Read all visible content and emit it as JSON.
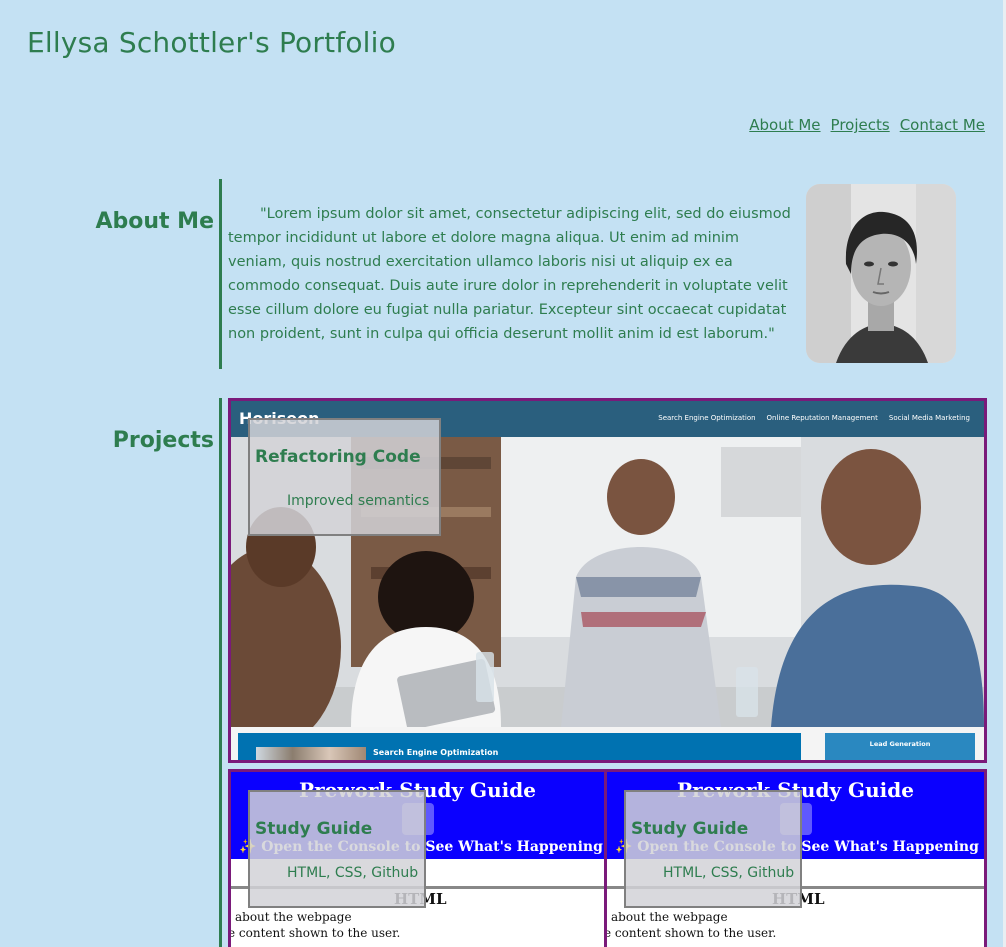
{
  "site": {
    "title": "Ellysa Schottler's Portfolio"
  },
  "nav": {
    "items": [
      "About Me",
      "Projects",
      "Contact Me"
    ]
  },
  "about": {
    "heading": "About Me",
    "text": "\"Lorem ipsum dolor sit amet, consectetur adipiscing elit, sed do eiusmod tempor incididunt ut labore et dolore magna aliqua. Ut enim ad minim veniam, quis nostrud exercitation ullamco laboris nisi ut aliquip ex ea commodo consequat. Duis aute irure dolor in reprehenderit in voluptate velit esse cillum dolore eu fugiat nulla pariatur. Excepteur sint occaecat cupidatat non proident, sunt in culpa qui officia deserunt mollit anim id est laborum.\""
  },
  "projects": {
    "heading": "Projects",
    "cards": [
      {
        "title": "Refactoring Code",
        "subtitle": "Improved semantics",
        "screenshot": {
          "logo": "Horiseon",
          "nav": [
            "Search Engine Optimization",
            "Online Reputation Management",
            "Social Media Marketing"
          ],
          "bottom_left": "Search Engine Optimization",
          "bottom_right": "Lead Generation"
        }
      },
      {
        "title": "Study Guide",
        "subtitle": "HTML, CSS, Github",
        "screenshot": {
          "heading": "Prework Study Guide",
          "banner": "✨ Open the Console to See What's Happening ✨",
          "section": "HTML",
          "line1": "about the webpage",
          "line2": "e content shown to the user."
        }
      },
      {
        "title": "Study Guide",
        "subtitle": "HTML, CSS, Github",
        "screenshot": {
          "heading": "Prework Study Guide",
          "banner": "✨ Open the Console to See What's Happening ✨",
          "section": "HTML",
          "line1": "about the webpage",
          "line2": "e content shown to the user."
        }
      }
    ]
  },
  "colors": {
    "background": "#c4e1f3",
    "accent": "#2e7d4f",
    "card_border": "#7a1a7a"
  }
}
